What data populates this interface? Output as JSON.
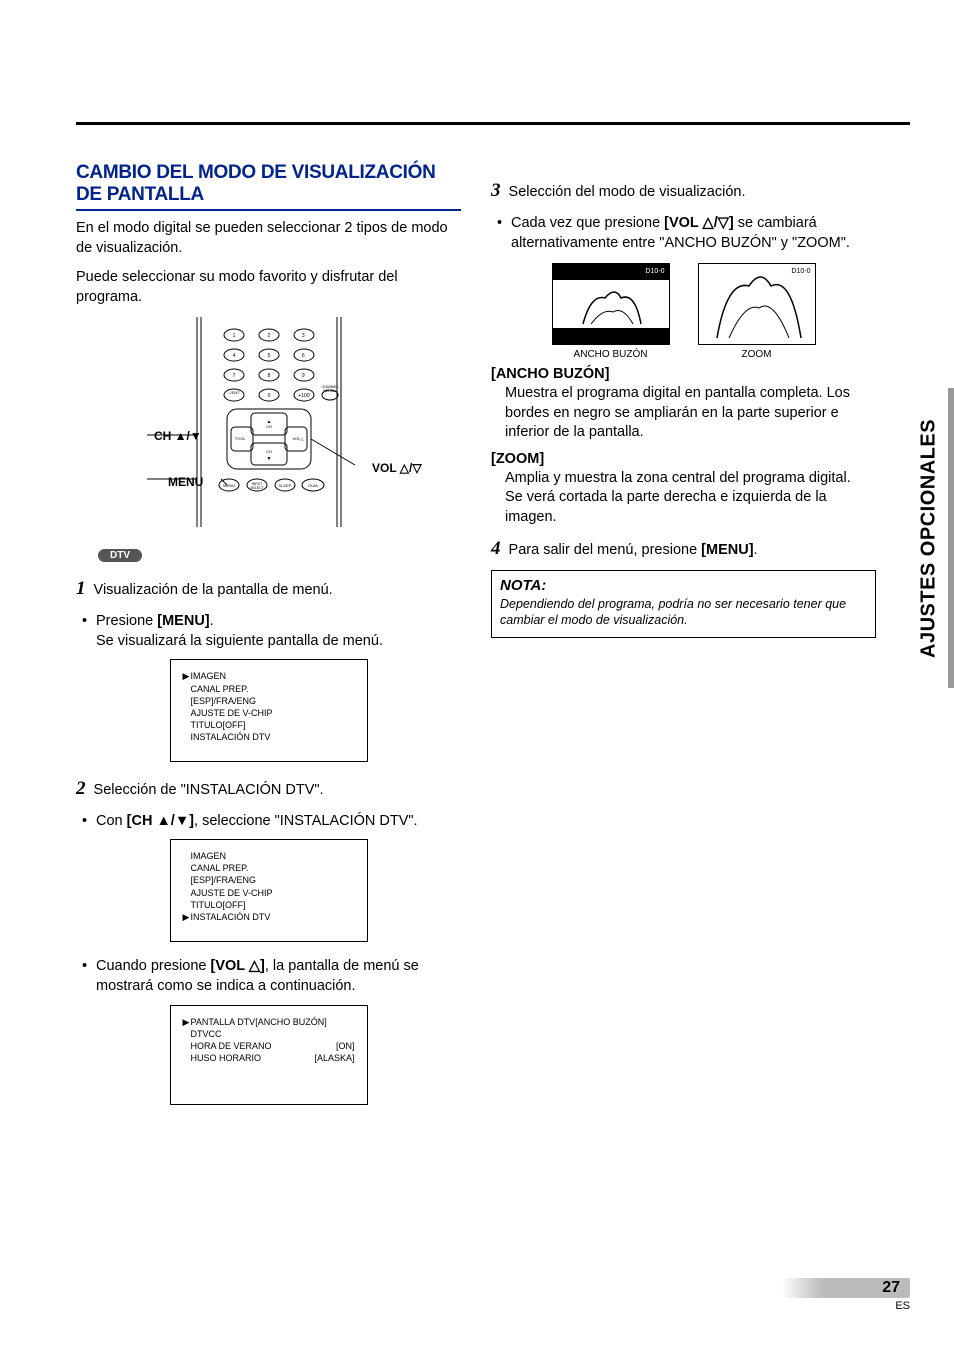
{
  "side_tab": "AJUSTES OPCIONALES",
  "page": {
    "number": "27",
    "lang": "ES"
  },
  "left": {
    "heading": "CAMBIO DEL MODO DE VISUALIZACIÓN DE PANTALLA",
    "intro1": "En el modo digital se pueden seleccionar 2 tipos de modo de visualización.",
    "intro2": "Puede seleccionar su modo favorito y disfrutar del programa.",
    "remote_labels": {
      "ch": "CH ▲/▼",
      "menu": "MENU",
      "vol": "VOL △/▽"
    },
    "dtv_pill": "DTV",
    "step1": {
      "num": "1",
      "text": "Visualización de la pantalla de menú."
    },
    "step1_bullet_line1": "Presione ",
    "step1_bullet_bold": "[MENU]",
    "step1_bullet_line2": ".",
    "step1_bullet_next": "Se visualizará la siguiente pantalla de menú.",
    "menu1": {
      "items": [
        "IMAGEN",
        "CANAL PREP.",
        "[ESP]/FRA/ENG",
        "AJUSTE DE V-CHIP",
        "TITULO[OFF]",
        "INSTALACIÓN DTV"
      ],
      "pointer": 0
    },
    "step2": {
      "num": "2",
      "text": "Selección de \"INSTALACIÓN DTV\"."
    },
    "step2_bullet_pre": "Con ",
    "step2_bullet_bold": "[CH ▲/▼]",
    "step2_bullet_post": ", seleccione \"INSTALACIÓN DTV\".",
    "menu2": {
      "items": [
        "IMAGEN",
        "CANAL PREP.",
        "[ESP]/FRA/ENG",
        "AJUSTE DE V-CHIP",
        "TITULO[OFF]",
        "INSTALACIÓN DTV"
      ],
      "pointer": 5
    },
    "step2_b2_pre": "Cuando presione ",
    "step2_b2_bold": "[VOL △]",
    "step2_b2_post": ", la pantalla de menú se mostrará como se indica a continuación.",
    "menu3": {
      "rows": [
        {
          "l": "PANTALLA DTV[ANCHO BUZÓN]",
          "r": ""
        },
        {
          "l": "DTVCC",
          "r": ""
        },
        {
          "l": "HORA DE VERANO",
          "r": "[ON]"
        },
        {
          "l": "HUSO HORARIO",
          "r": "[ALASKA]"
        }
      ],
      "pointer": 0
    }
  },
  "right": {
    "step3": {
      "num": "3",
      "text": "Selección del modo de visualización."
    },
    "step3_bullet_pre": "Cada vez que presione ",
    "step3_bullet_bold": "[VOL △/▽]",
    "step3_bullet_post": " se cambiará alternativamente entre \"ANCHO BUZÓN\" y \"ZOOM\".",
    "tv": {
      "ch": "D10-0",
      "cap_left": "ANCHO BUZÓN",
      "cap_right": "ZOOM"
    },
    "ancho_head": "[ANCHO BUZÓN]",
    "ancho_body": "Muestra el programa digital en pantalla completa. Los bordes en negro se ampliarán en la parte superior e inferior de la pantalla.",
    "zoom_head": "[ZOOM]",
    "zoom_line1": "Amplia y muestra la zona central del programa digital.",
    "zoom_line2": "Se verá cortada la parte derecha e izquierda de la imagen.",
    "step4": {
      "num": "4",
      "pre": "Para salir del menú, presione ",
      "bold": "[MENU]",
      "post": "."
    },
    "note": {
      "title": "NOTA:",
      "body": "Dependiendo del programa, podría no ser necesario tener que cambiar el modo de visualización."
    }
  }
}
